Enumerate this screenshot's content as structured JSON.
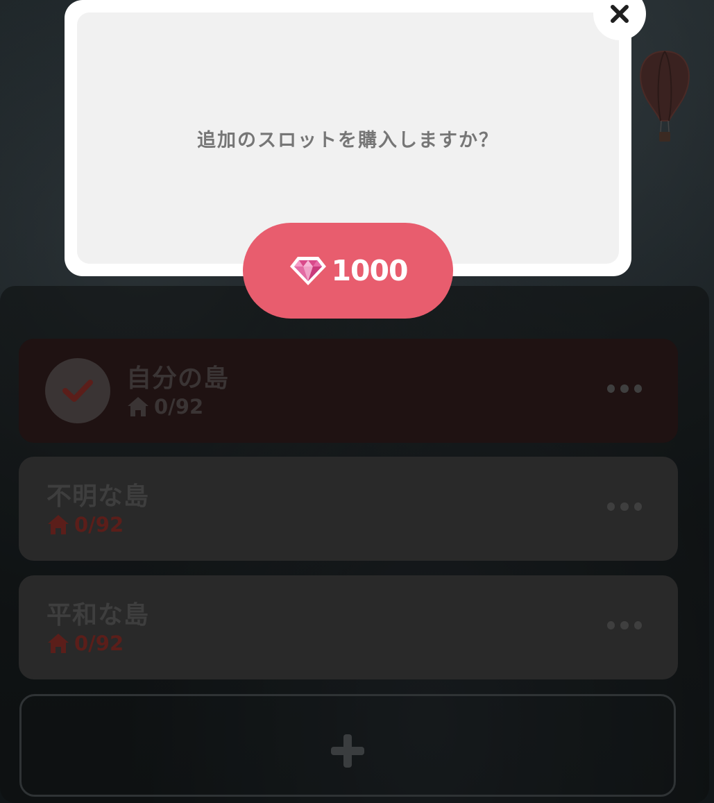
{
  "dialog": {
    "message": "追加のスロットを購入しますか？",
    "close_label": "✕",
    "price": "1000",
    "price_icon": "gem-icon"
  },
  "slots": [
    {
      "name": "自分の島",
      "count": "0/92",
      "selected": true
    },
    {
      "name": "不明な島",
      "count": "0/92",
      "selected": false
    },
    {
      "name": "平和な島",
      "count": "0/92",
      "selected": false
    }
  ],
  "add_slot": {
    "icon": "plus-icon"
  },
  "colors": {
    "buy_button": "#e85d6e",
    "house_icon": "#5b1e1a",
    "selected_slot": "#1f1212",
    "overlay": "#0f1416"
  }
}
